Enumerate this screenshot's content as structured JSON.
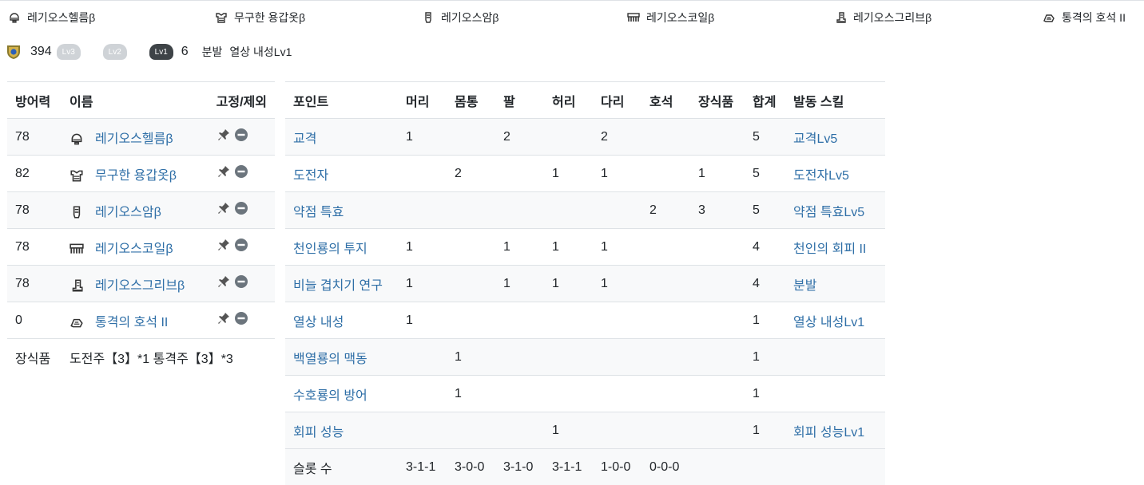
{
  "equipment": [
    {
      "name": "레기오스헬름β",
      "icon": "helmet-icon"
    },
    {
      "name": "무구한 용갑옷β",
      "icon": "chest-armor-icon"
    },
    {
      "name": "레기오스암β",
      "icon": "arm-guard-icon"
    },
    {
      "name": "레기오스코일β",
      "icon": "waist-coil-icon"
    },
    {
      "name": "레기오스그리브β",
      "icon": "greaves-icon"
    },
    {
      "name": "통격의 호석 II",
      "icon": "charm-icon"
    }
  ],
  "stats": {
    "defense": "394",
    "slot_lv3": "Lv3",
    "slot_lv2": "Lv2",
    "slot_lv1": "Lv1",
    "slot_lv1_count": "6",
    "skill_tag_1": "분발",
    "skill_tag_2": "열상 내성Lv1"
  },
  "armor_table": {
    "headers": {
      "defense": "방어력",
      "name": "이름",
      "fix": "고정/제외"
    },
    "rows": [
      {
        "defense": "78",
        "name": "레기오스헬름β"
      },
      {
        "defense": "82",
        "name": "무구한 용갑옷β"
      },
      {
        "defense": "78",
        "name": "레기오스암β"
      },
      {
        "defense": "78",
        "name": "레기오스코일β"
      },
      {
        "defense": "78",
        "name": "레기오스그리브β"
      },
      {
        "defense": "0",
        "name": "통격의 호석 II"
      }
    ],
    "decoration": {
      "label": "장식품",
      "value": "도전주【3】*1 통격주【3】*3"
    }
  },
  "skill_table": {
    "headers": [
      "포인트",
      "머리",
      "몸통",
      "팔",
      "허리",
      "다리",
      "호석",
      "장식품",
      "합계",
      "발동 스킬"
    ],
    "rows": [
      {
        "point": "교격",
        "head": "1",
        "body": "",
        "arm": "2",
        "waist": "",
        "leg": "2",
        "charm": "",
        "deco": "",
        "total": "5",
        "skill": "교격Lv5"
      },
      {
        "point": "도전자",
        "head": "",
        "body": "2",
        "arm": "",
        "waist": "1",
        "leg": "1",
        "charm": "",
        "deco": "1",
        "total": "5",
        "skill": "도전자Lv5"
      },
      {
        "point": "약점 특효",
        "head": "",
        "body": "",
        "arm": "",
        "waist": "",
        "leg": "",
        "charm": "2",
        "deco": "3",
        "total": "5",
        "skill": "약점 특효Lv5"
      },
      {
        "point": "천인룡의 투지",
        "head": "1",
        "body": "",
        "arm": "1",
        "waist": "1",
        "leg": "1",
        "charm": "",
        "deco": "",
        "total": "4",
        "skill": "천인의 회피 II"
      },
      {
        "point": "비늘 겹치기 연구",
        "head": "1",
        "body": "",
        "arm": "1",
        "waist": "1",
        "leg": "1",
        "charm": "",
        "deco": "",
        "total": "4",
        "skill": "분발"
      },
      {
        "point": "열상 내성",
        "head": "1",
        "body": "",
        "arm": "",
        "waist": "",
        "leg": "",
        "charm": "",
        "deco": "",
        "total": "1",
        "skill": "열상 내성Lv1"
      },
      {
        "point": "백열룡의 맥동",
        "head": "",
        "body": "1",
        "arm": "",
        "waist": "",
        "leg": "",
        "charm": "",
        "deco": "",
        "total": "1",
        "skill": ""
      },
      {
        "point": "수호룡의 방어",
        "head": "",
        "body": "1",
        "arm": "",
        "waist": "",
        "leg": "",
        "charm": "",
        "deco": "",
        "total": "1",
        "skill": ""
      },
      {
        "point": "회피 성능",
        "head": "",
        "body": "",
        "arm": "",
        "waist": "1",
        "leg": "",
        "charm": "",
        "deco": "",
        "total": "1",
        "skill": "회피 성능Lv1"
      }
    ],
    "slots": {
      "label": "슬롯 수",
      "head": "3-1-1",
      "body": "3-0-0",
      "arm": "3-1-0",
      "waist": "3-1-1",
      "leg": "1-0-0",
      "charm": "0-0-0"
    }
  }
}
